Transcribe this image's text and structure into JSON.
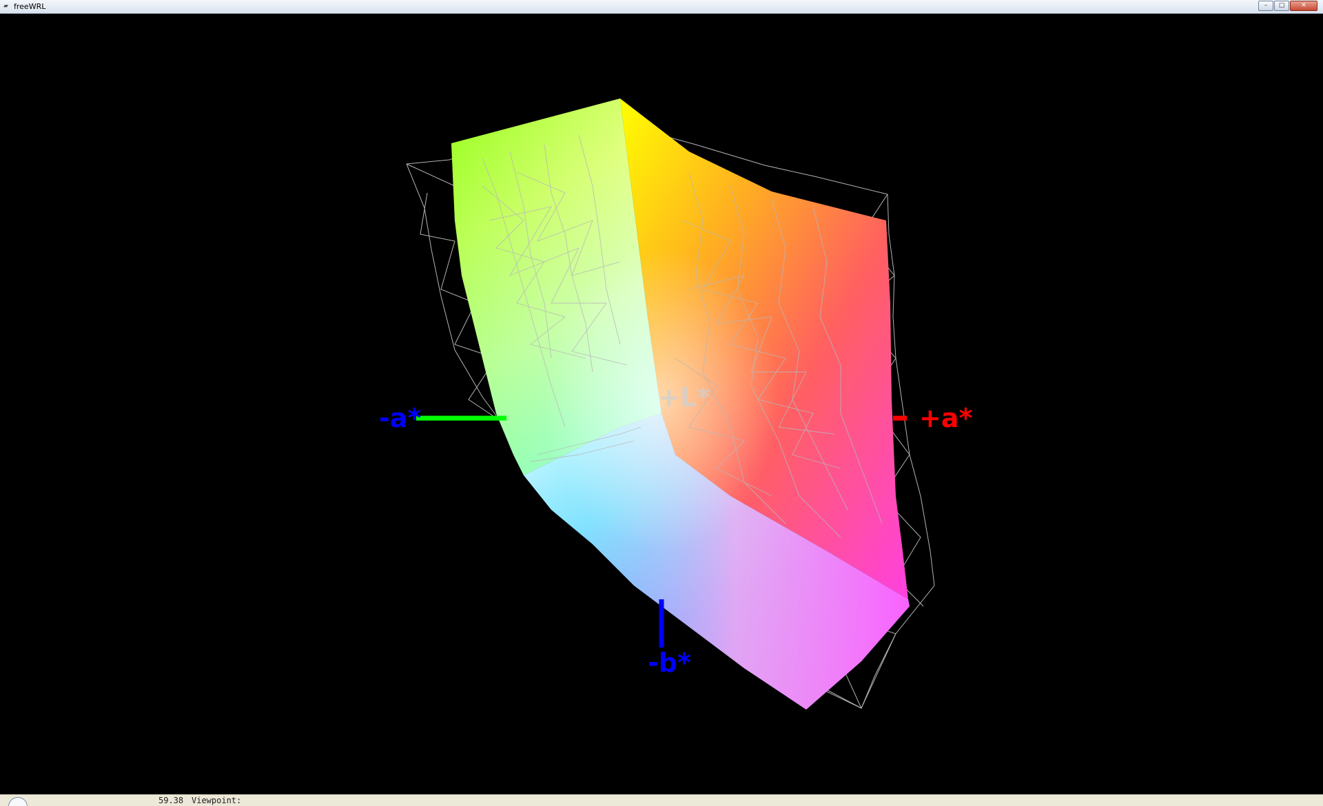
{
  "window": {
    "title": "freeWRL",
    "icon": "app-icon",
    "controls": {
      "minimize_glyph": "–",
      "maximize_glyph": "□",
      "close_glyph": "✕"
    }
  },
  "viewport": {
    "background": "#000000",
    "axis_labels": {
      "neg_a": "-a*",
      "pos_a": "+a*",
      "neg_b": "-b*",
      "pos_l": "+L*"
    },
    "axis_colors": {
      "neg_a_label": "#0000ff",
      "neg_a_axis": "#00ff00",
      "pos_a": "#ff0000",
      "neg_b": "#0000ff",
      "pos_l": "#d0d0d0"
    },
    "mesh_color": "#c8c8c8"
  },
  "statusbar": {
    "fps": "59.38",
    "label": "Viewpoint:",
    "icon": "viewpoint-icon"
  }
}
